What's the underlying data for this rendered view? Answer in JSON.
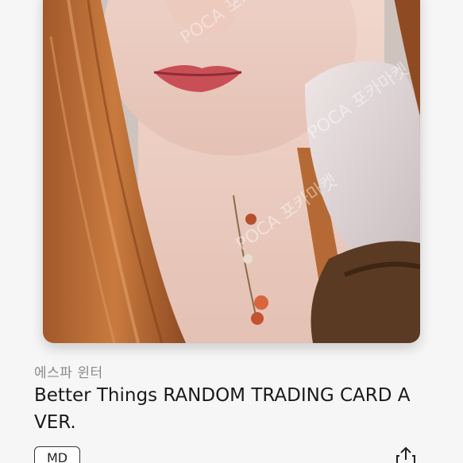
{
  "product": {
    "artist_member": "에스파 윈터",
    "title": "Better Things RANDOM TRADING CARD A VER.",
    "badge": "MD",
    "watermark": "POCA 포카마켓"
  },
  "icons": {
    "share": "share-icon"
  },
  "colors": {
    "background": "#f6f6f6",
    "artist_text": "#8a8a8a",
    "title_text": "#1a1a1a"
  }
}
